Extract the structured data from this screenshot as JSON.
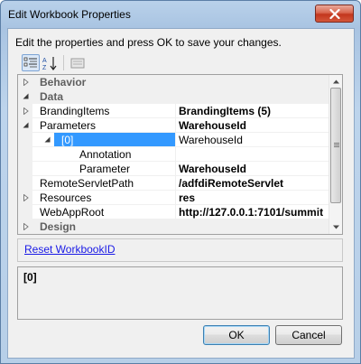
{
  "window": {
    "title": "Edit Workbook Properties",
    "close_icon": "close-icon"
  },
  "description": "Edit the properties and press OK to save your changes.",
  "toolbar": {
    "categorized_icon": "categorized-view-icon",
    "alphabetical_icon": "alphabetical-sort-icon",
    "property_pages_icon": "property-pages-icon"
  },
  "grid": {
    "rows": [
      {
        "name": "Behavior",
        "value": "",
        "category": true,
        "expanded": false
      },
      {
        "name": "Data",
        "value": "",
        "category": true,
        "expanded": true
      },
      {
        "name": "BrandingItems",
        "value": "BrandingItems (5)",
        "expanded": false
      },
      {
        "name": "Parameters",
        "value": "WarehouseId",
        "expanded": true
      },
      {
        "name": "[0]",
        "value": "WarehouseId",
        "expanded": true,
        "selected": true
      },
      {
        "name": "Annotation",
        "value": ""
      },
      {
        "name": "Parameter",
        "value": "WarehouseId"
      },
      {
        "name": "RemoteServletPath",
        "value": "/adfdiRemoteServlet"
      },
      {
        "name": "Resources",
        "value": "res",
        "expanded": false
      },
      {
        "name": "WebAppRoot",
        "value": "http://127.0.0.1:7101/summit"
      },
      {
        "name": "Design",
        "value": "",
        "category": true,
        "expanded": false
      }
    ]
  },
  "commands": {
    "reset_link": "Reset WorkbookID"
  },
  "help": {
    "title": "[0]"
  },
  "buttons": {
    "ok": "OK",
    "cancel": "Cancel"
  },
  "colors": {
    "selection": "#3399ff",
    "link": "#1a1ae6"
  }
}
